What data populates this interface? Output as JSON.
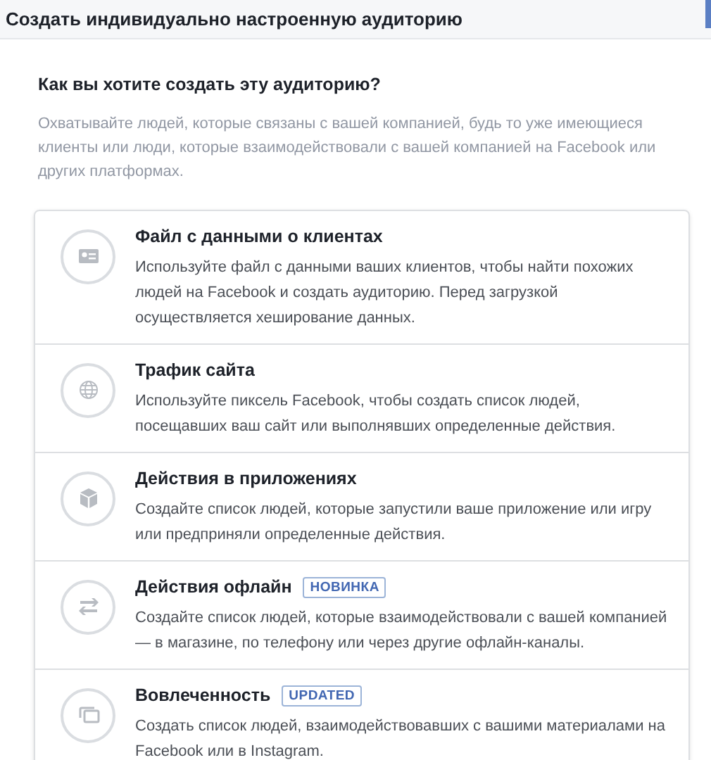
{
  "header": {
    "title": "Создать индивидуально настроенную аудиторию"
  },
  "question": "Как вы хотите создать эту аудиторию?",
  "description": "Охватывайте людей, которые связаны с вашей компанией, будь то уже имеющиеся клиенты или люди, которые взаимодействовали с вашей компанией на Facebook или других платформах.",
  "options": [
    {
      "title": "Файл с данными о клиентах",
      "text": "Используйте файл с данными ваших клиентов, чтобы найти похожих людей на Facebook и создать аудиторию. Перед загрузкой осуществляется хеширование данных."
    },
    {
      "title": "Трафик сайта",
      "text": "Используйте пиксель Facebook, чтобы создать список людей, посещавших ваш сайт или выполнявших определенные действия."
    },
    {
      "title": "Действия в приложениях",
      "text": "Создайте список людей, которые запустили ваше приложение или игру или предприняли определенные действия."
    },
    {
      "title": "Действия офлайн",
      "badge": "НОВИНКА",
      "text": "Создайте список людей, которые взаимодействовали с вашей компанией — в магазине, по телефону или через другие офлайн-каналы."
    },
    {
      "title": "Вовлеченность",
      "badge": "UPDATED",
      "text": "Создать список людей, взаимодействовавших с вашими материалами на Facebook или в Instagram."
    }
  ]
}
